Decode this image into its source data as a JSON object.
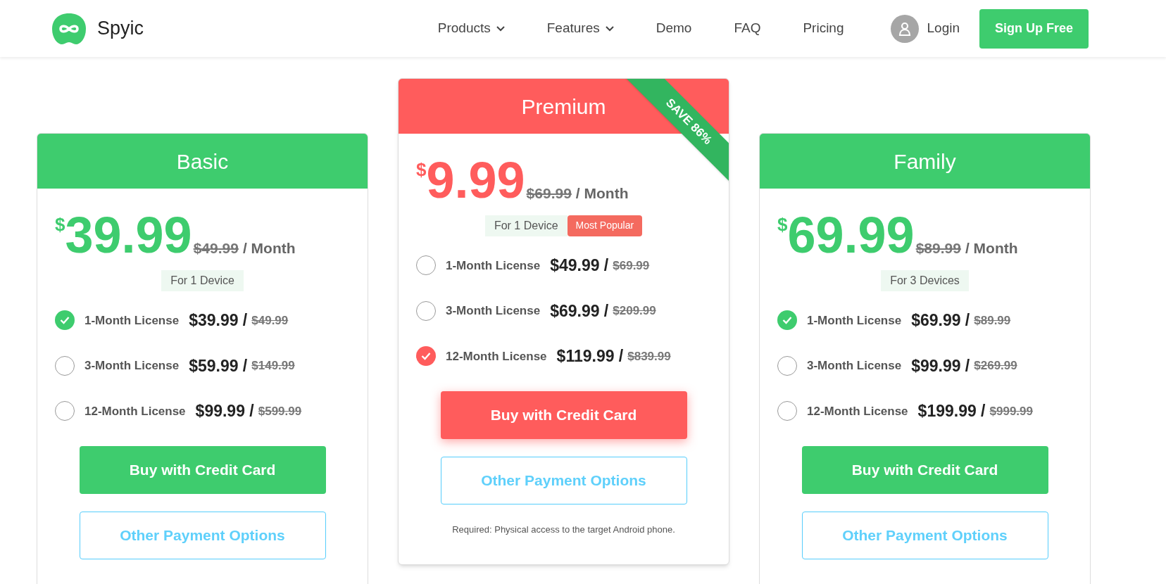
{
  "header": {
    "brand": "Spyic",
    "nav": [
      {
        "label": "Products",
        "dropdown": true
      },
      {
        "label": "Features",
        "dropdown": true
      },
      {
        "label": "Demo",
        "dropdown": false
      },
      {
        "label": "FAQ",
        "dropdown": false
      },
      {
        "label": "Pricing",
        "dropdown": false
      }
    ],
    "login": "Login",
    "signup": "Sign Up Free"
  },
  "plans": [
    {
      "name": "Basic",
      "color": "#3ecc6e",
      "currency": "$",
      "price": "39.99",
      "old_price": "$49.99",
      "period": "/ Month",
      "devices": "For 1 Device",
      "options": [
        {
          "label": "1-Month License",
          "price": "$39.99 /",
          "old_price": "$49.99",
          "selected": true
        },
        {
          "label": "3-Month License",
          "price": "$59.99 /",
          "old_price": "$149.99",
          "selected": false
        },
        {
          "label": "12-Month License",
          "price": "$99.99 /",
          "old_price": "$599.99",
          "selected": false
        }
      ],
      "buy": "Buy with Credit Card",
      "other": "Other Payment Options"
    },
    {
      "name": "Premium",
      "color": "#ff5c5c",
      "ribbon": "SAVE 86%",
      "currency": "$",
      "price": "9.99",
      "old_price": "$69.99",
      "period": "/ Month",
      "devices": "For 1 Device",
      "badge": "Most Popular",
      "options": [
        {
          "label": "1-Month License",
          "price": "$49.99 /",
          "old_price": "$69.99",
          "selected": false
        },
        {
          "label": "3-Month License",
          "price": "$69.99 /",
          "old_price": "$209.99",
          "selected": false
        },
        {
          "label": "12-Month License",
          "price": "$119.99 /",
          "old_price": "$839.99",
          "selected": true
        }
      ],
      "buy": "Buy with Credit Card",
      "other": "Other Payment Options",
      "note": "Required: Physical access to the target Android phone."
    },
    {
      "name": "Family",
      "color": "#3ecc6e",
      "currency": "$",
      "price": "69.99",
      "old_price": "$89.99",
      "period": "/ Month",
      "devices": "For 3 Devices",
      "options": [
        {
          "label": "1-Month License",
          "price": "$69.99 /",
          "old_price": "$89.99",
          "selected": true
        },
        {
          "label": "3-Month License",
          "price": "$99.99 /",
          "old_price": "$269.99",
          "selected": false
        },
        {
          "label": "12-Month License",
          "price": "$199.99 /",
          "old_price": "$999.99",
          "selected": false
        }
      ],
      "buy": "Buy with Credit Card",
      "other": "Other Payment Options"
    }
  ]
}
